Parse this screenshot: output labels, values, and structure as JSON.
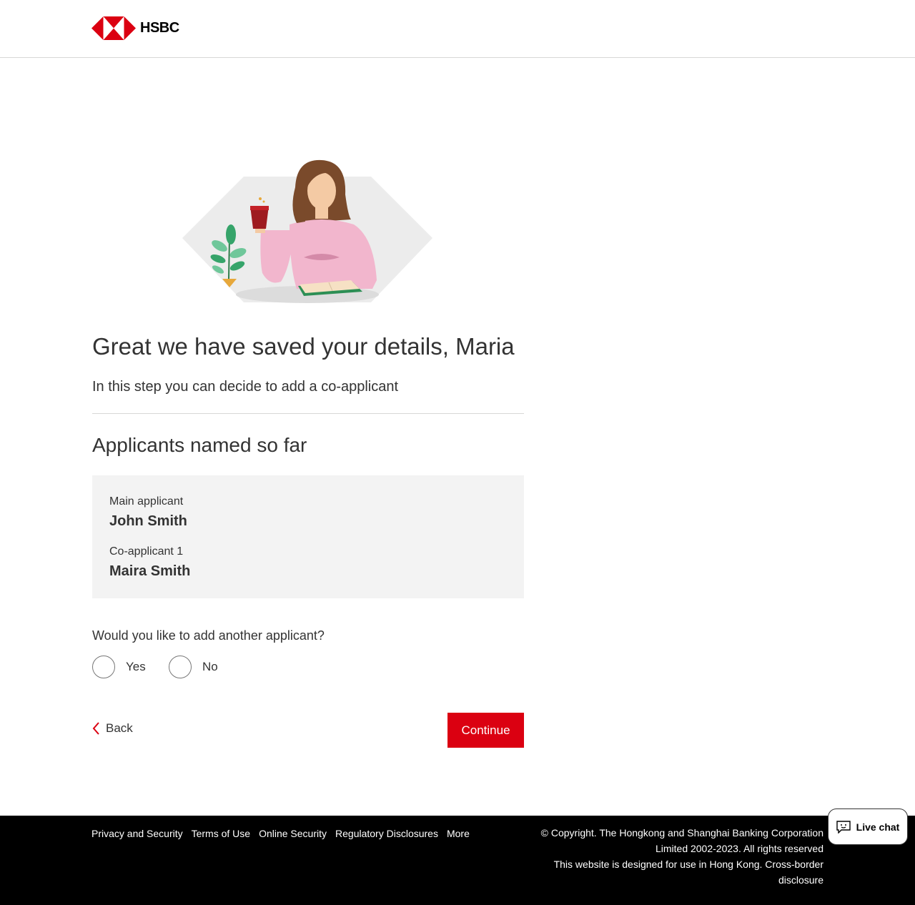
{
  "header": {
    "brand": "HSBC",
    "brand_colors": {
      "red": "#DB0011",
      "white": "#FFFFFF"
    }
  },
  "hero": {
    "illustration": "woman-with-coffee-cup-illustration"
  },
  "main": {
    "title": "Great we have saved your details, Maria",
    "subtitle": "In this step you can decide to add a co-applicant",
    "section_title": "Applicants named so far",
    "applicants": [
      {
        "role": "Main applicant",
        "name": "John Smith"
      },
      {
        "role": "Co-applicant 1",
        "name": "Maira Smith"
      }
    ],
    "question": "Would you like to add another applicant?",
    "options": [
      {
        "label": "Yes",
        "selected": false
      },
      {
        "label": "No",
        "selected": false
      }
    ],
    "back_label": "Back",
    "continue_label": "Continue"
  },
  "footer": {
    "links": [
      "Privacy and Security",
      "Terms of Use",
      "Online Security",
      "Regulatory Disclosures",
      "More"
    ],
    "copyright": "© Copyright. The Hongkong and Shanghai Banking Corporation Limited 2002-2023. All rights reserved",
    "disclosure": "This website is designed for use in Hong Kong. Cross-border disclosure"
  },
  "live_chat": {
    "label": "Live chat",
    "icon": "chat-icon"
  },
  "colors": {
    "accent": "#DB0011",
    "text": "#333333",
    "panel": "#F3F3F3",
    "footer_bg": "#000000"
  }
}
